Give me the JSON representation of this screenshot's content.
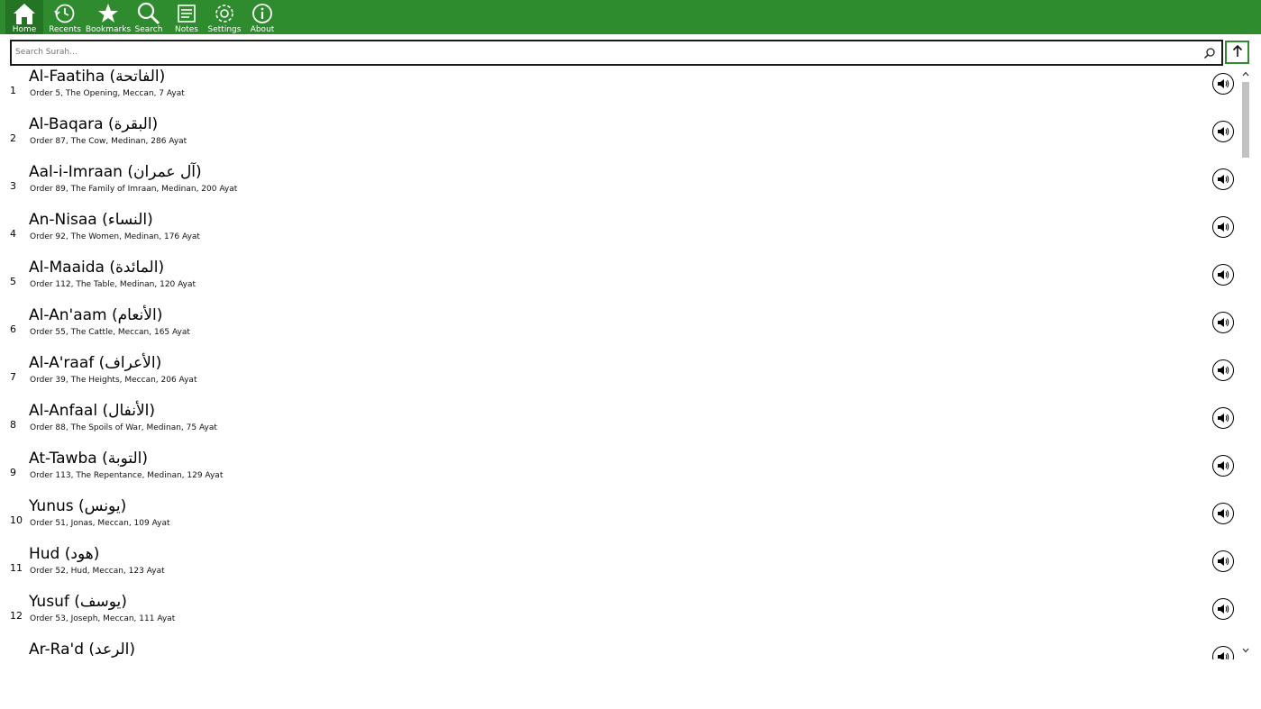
{
  "nav": {
    "items": [
      {
        "label": "Home",
        "icon": "home-icon"
      },
      {
        "label": "Recents",
        "icon": "history-icon"
      },
      {
        "label": "Bookmarks",
        "icon": "star-icon"
      },
      {
        "label": "Search",
        "icon": "search-icon"
      },
      {
        "label": "Notes",
        "icon": "notes-icon"
      },
      {
        "label": "Settings",
        "icon": "gear-icon"
      },
      {
        "label": "About",
        "icon": "info-icon"
      }
    ],
    "color": "#2e8b2e"
  },
  "search": {
    "placeholder": "Search Surah..."
  },
  "surahs": [
    {
      "num": "1",
      "name": "Al-Faatiha (الفاتحة)",
      "desc": "Order 5, The Opening, Meccan, 7 Ayat"
    },
    {
      "num": "2",
      "name": "Al-Baqara (البقرة)",
      "desc": "Order 87, The Cow, Medinan, 286 Ayat"
    },
    {
      "num": "3",
      "name": "Aal-i-Imraan (آل عمران)",
      "desc": "Order 89, The Family of Imraan, Medinan, 200 Ayat"
    },
    {
      "num": "4",
      "name": "An-Nisaa (النساء)",
      "desc": "Order 92, The Women, Medinan, 176 Ayat"
    },
    {
      "num": "5",
      "name": "Al-Maaida (المائدة)",
      "desc": "Order 112, The Table, Medinan, 120 Ayat"
    },
    {
      "num": "6",
      "name": "Al-An'aam (الأنعام)",
      "desc": "Order 55, The Cattle, Meccan, 165 Ayat"
    },
    {
      "num": "7",
      "name": "Al-A'raaf (الأعراف)",
      "desc": "Order 39, The Heights, Meccan, 206 Ayat"
    },
    {
      "num": "8",
      "name": "Al-Anfaal (الأنفال)",
      "desc": "Order 88, The Spoils of War, Medinan, 75 Ayat"
    },
    {
      "num": "9",
      "name": "At-Tawba (التوبة)",
      "desc": "Order 113, The Repentance, Medinan, 129 Ayat"
    },
    {
      "num": "10",
      "name": "Yunus (يونس)",
      "desc": "Order 51, Jonas, Meccan, 109 Ayat"
    },
    {
      "num": "11",
      "name": "Hud (هود)",
      "desc": "Order 52, Hud, Meccan, 123 Ayat"
    },
    {
      "num": "12",
      "name": "Yusuf (يوسف)",
      "desc": "Order 53, Joseph, Meccan, 111 Ayat"
    },
    {
      "num": "",
      "name": "Ar-Ra'd (الرعد)",
      "desc": ""
    }
  ]
}
